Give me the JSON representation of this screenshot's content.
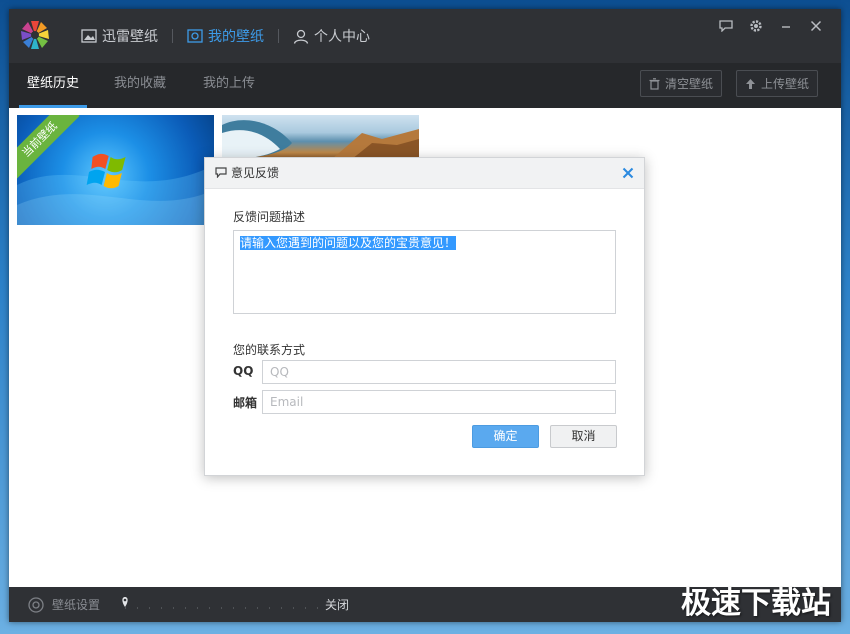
{
  "nav": {
    "items": [
      {
        "label": "迅雷壁纸",
        "icon": "image-icon"
      },
      {
        "label": "我的壁纸",
        "icon": "my-wallpaper-icon"
      },
      {
        "label": "个人中心",
        "icon": "user-icon"
      }
    ],
    "active": 1
  },
  "window_controls": [
    "feedback-icon",
    "gear-icon",
    "minimize-icon",
    "close-icon"
  ],
  "tabs": [
    {
      "label": "壁纸历史"
    },
    {
      "label": "我的收藏"
    },
    {
      "label": "我的上传"
    }
  ],
  "actions": {
    "clear_label": "清空壁纸",
    "upload_label": "上传壁纸"
  },
  "thumbs": {
    "current_badge": "当前壁纸"
  },
  "dialog": {
    "title": "意见反馈",
    "desc_label": "反馈问题描述",
    "desc_value": "请输入您遇到的问题以及您的宝贵意见！",
    "contact_label": "您的联系方式",
    "qq_label": "QQ",
    "qq_placeholder": "QQ",
    "email_label": "邮箱",
    "email_placeholder": "Email",
    "ok_label": "确定",
    "cancel_label": "取消"
  },
  "bottom": {
    "settings_label": "壁纸设置",
    "slider_state": "关闭",
    "watermark": "极速下载站"
  },
  "colors": {
    "accent": "#3d9be8",
    "titlebar": "#2f3135",
    "ribbon": "#6ab43e"
  }
}
